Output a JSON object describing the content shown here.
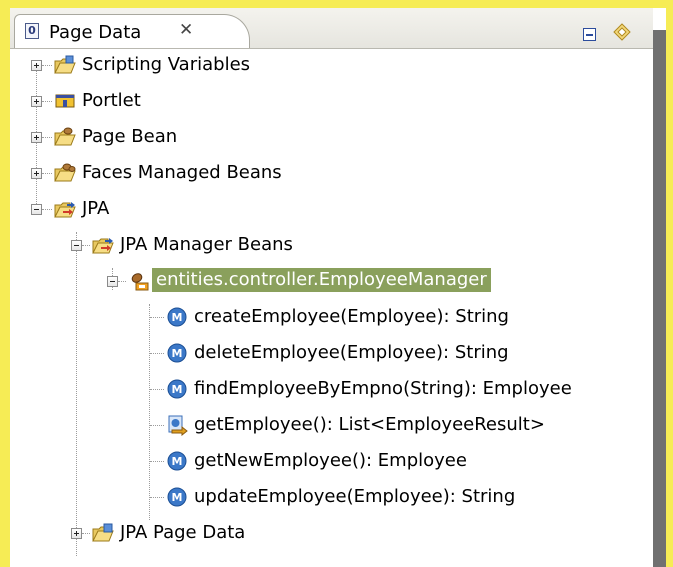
{
  "view": {
    "title": "Page Data",
    "close_icon": "close-icon",
    "minimize_icon": "minimize-icon",
    "menu_icon": "view-menu-icon"
  },
  "tree": {
    "scripting_variables": "Scripting Variables",
    "portlet": "Portlet",
    "page_bean": "Page Bean",
    "faces_managed_beans": "Faces Managed Beans",
    "jpa": "JPA",
    "jpa_manager_beans": "JPA Manager Beans",
    "employee_manager": "entities.controller.EmployeeManager",
    "methods": [
      "createEmployee(Employee): String",
      "deleteEmployee(Employee): String",
      "findEmployeeByEmpno(String): Employee",
      "getEmployee(): List<EmployeeResult>",
      "getNewEmployee(): Employee",
      "updateEmployee(Employee): String"
    ],
    "jpa_page_data": "JPA Page Data"
  },
  "colors": {
    "frame": "#f6ec55",
    "selection": "#8aa05c",
    "method_icon": "#3b78c8"
  }
}
